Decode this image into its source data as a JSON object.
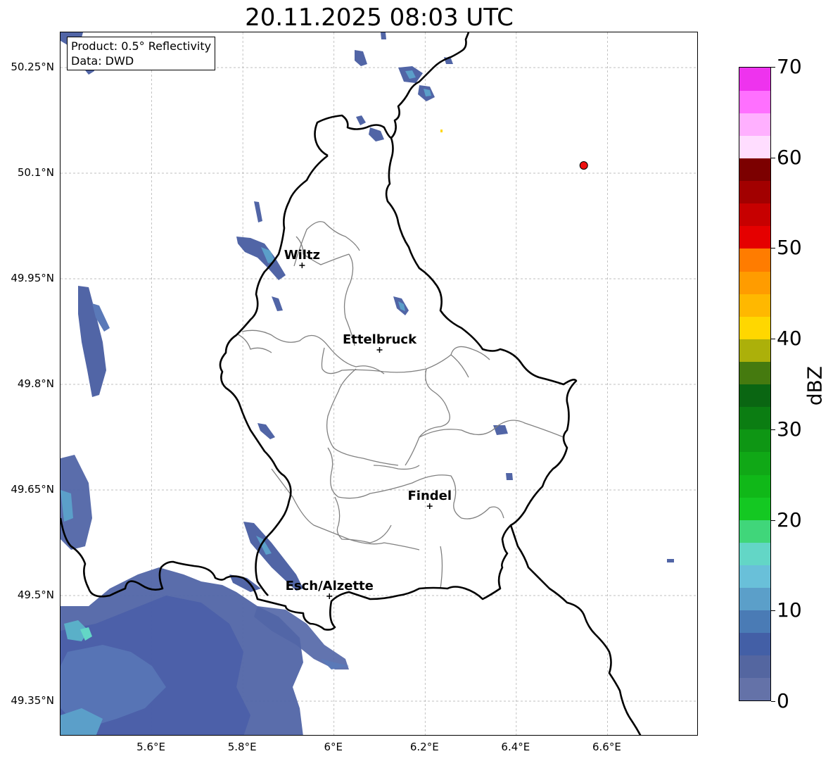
{
  "title": "20.11.2025 08:03 UTC",
  "info_box": {
    "product": "Product: 0.5° Reflectivity",
    "data": "Data: DWD"
  },
  "lat_labels": [
    {
      "text": "50.25°N",
      "value": 50.25
    },
    {
      "text": "50.1°N",
      "value": 50.1
    },
    {
      "text": "49.95°N",
      "value": 49.95
    },
    {
      "text": "49.8°N",
      "value": 49.8
    },
    {
      "text": "49.65°N",
      "value": 49.65
    },
    {
      "text": "49.5°N",
      "value": 49.5
    },
    {
      "text": "49.35°N",
      "value": 49.35
    }
  ],
  "lon_labels": [
    {
      "text": "5.6°E",
      "value": 5.6
    },
    {
      "text": "5.8°E",
      "value": 5.8
    },
    {
      "text": "6°E",
      "value": 6.0
    },
    {
      "text": "6.2°E",
      "value": 6.2
    },
    {
      "text": "6.4°E",
      "value": 6.4
    },
    {
      "text": "6.6°E",
      "value": 6.6
    }
  ],
  "extent": {
    "lon_min": 5.4,
    "lon_max": 6.8,
    "lat_min": 49.3,
    "lat_max": 50.3
  },
  "cities": [
    {
      "name": "Wiltz",
      "lon": 5.93,
      "lat": 49.969
    },
    {
      "name": "Ettelbruck",
      "lon": 6.1,
      "lat": 49.849
    },
    {
      "name": "Findel",
      "lon": 6.21,
      "lat": 49.627
    },
    {
      "name": "Esch/Alzette",
      "lon": 5.99,
      "lat": 49.499
    }
  ],
  "radar_site": {
    "lon": 6.548,
    "lat": 50.111,
    "color": "#ee1111"
  },
  "colorbar": {
    "unit": "dBZ",
    "min": 0,
    "max": 70,
    "tick_labels": [
      "0",
      "10",
      "20",
      "30",
      "40",
      "50",
      "60",
      "70"
    ],
    "tick_values": [
      0,
      10,
      20,
      30,
      40,
      50,
      60,
      70
    ],
    "colors": [
      "#6472a8",
      "#5466a0",
      "#435fa6",
      "#4a7bb5",
      "#5b9fc9",
      "#69c0d9",
      "#63d6c6",
      "#40d67a",
      "#14c822",
      "#10b818",
      "#10a816",
      "#0e9614",
      "#0b7d12",
      "#0a6612",
      "#457a0f",
      "#acb00a",
      "#ffd700",
      "#ffb800",
      "#ff9c00",
      "#ff7c00",
      "#e50000",
      "#c70000",
      "#a20000",
      "#7c0000",
      "#ffddff",
      "#ffb0ff",
      "#ff70ff",
      "#ee33ee"
    ]
  },
  "colors": {
    "border": "#000000",
    "cantons": "#808080",
    "grid": "#aaaaaa"
  }
}
